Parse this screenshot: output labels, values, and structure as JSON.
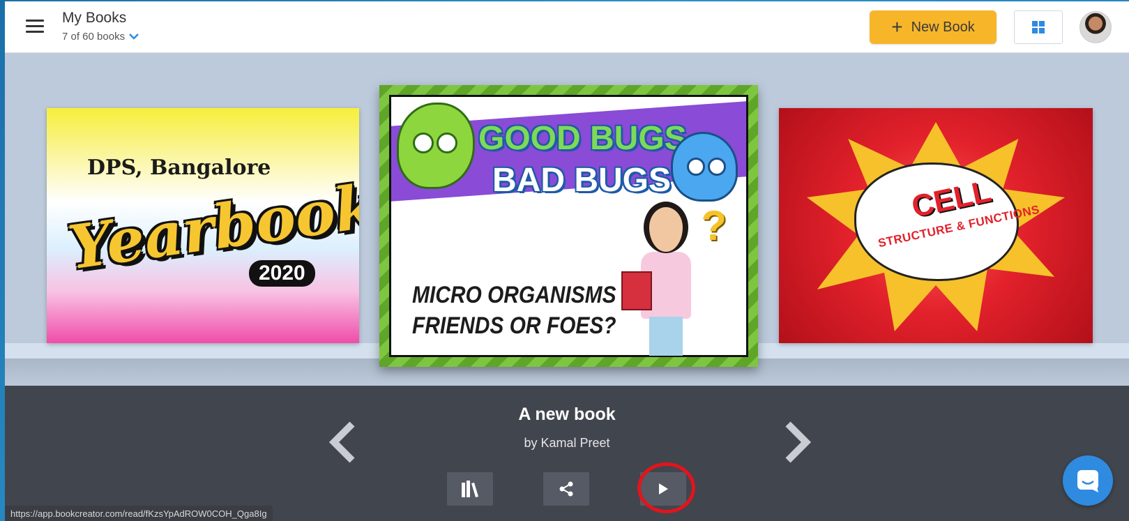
{
  "header": {
    "title": "My Books",
    "count": "7 of 60 books",
    "new_book_label": "New Book"
  },
  "books": {
    "left": {
      "line1": "DPS, Bangalore",
      "line2": "Yearbook",
      "line3": "2020"
    },
    "center": {
      "line1": "GOOD BUGS",
      "line2": "BAD BUGS",
      "line3": "MICRO ORGANISMS",
      "line4": "FRIENDS OR FOES?"
    },
    "right": {
      "line1": "CELL",
      "line2": "STRUCTURE & FUNCTIONS"
    }
  },
  "selected": {
    "title": "A new book",
    "author": "by Kamal Preet"
  },
  "status_url": "https://app.bookcreator.com/read/fKzsYpAdROW0COH_Qga8Ig",
  "colors": {
    "accent": "#f7b52a",
    "panel": "#41454e",
    "highlight": "#e3141c",
    "chat": "#2f8be0"
  },
  "icons": [
    "menu-icon",
    "chevron-down-icon",
    "plus-icon",
    "grid-icon",
    "chevron-left-icon",
    "chevron-right-icon",
    "library-icon",
    "share-icon",
    "play-icon",
    "chat-icon"
  ]
}
